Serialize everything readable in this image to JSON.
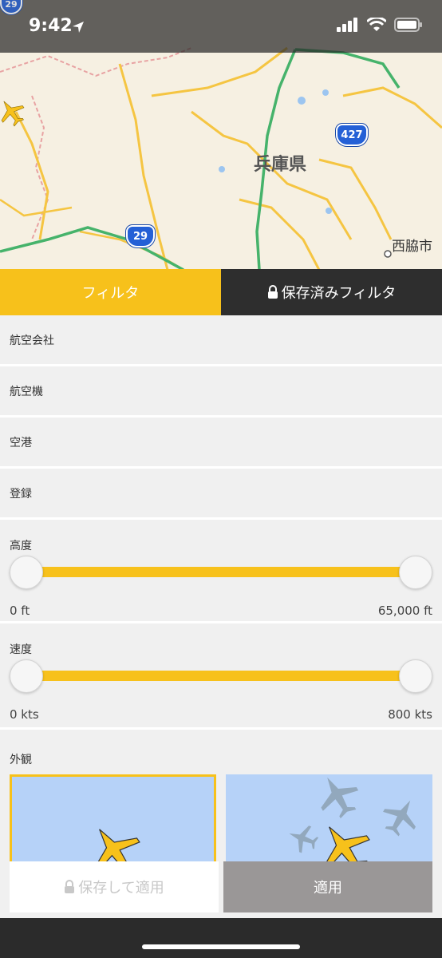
{
  "status_bar": {
    "time": "9:42"
  },
  "map": {
    "prefecture_label": "兵庫県",
    "city_label": "西脇市",
    "route_shields": [
      "29",
      "427",
      "29"
    ]
  },
  "tabs": {
    "filter": "フィルタ",
    "saved": "保存済みフィルタ"
  },
  "filters": {
    "airline": "航空会社",
    "aircraft": "航空機",
    "airport": "空港",
    "registration": "登録"
  },
  "altitude": {
    "label": "高度",
    "min": "0 ft",
    "max": "65,000 ft",
    "range": [
      0,
      1
    ]
  },
  "speed": {
    "label": "速度",
    "min": "0 kts",
    "max": "800 kts",
    "range": [
      0,
      1
    ]
  },
  "appearance": {
    "label": "外観"
  },
  "buttons": {
    "save_apply": "保存して適用",
    "apply": "適用"
  },
  "colors": {
    "accent": "#f7c11b",
    "dark": "#2e2e2e",
    "panel": "#f0f0f0",
    "thumb_bg": "#b6d2f8"
  }
}
